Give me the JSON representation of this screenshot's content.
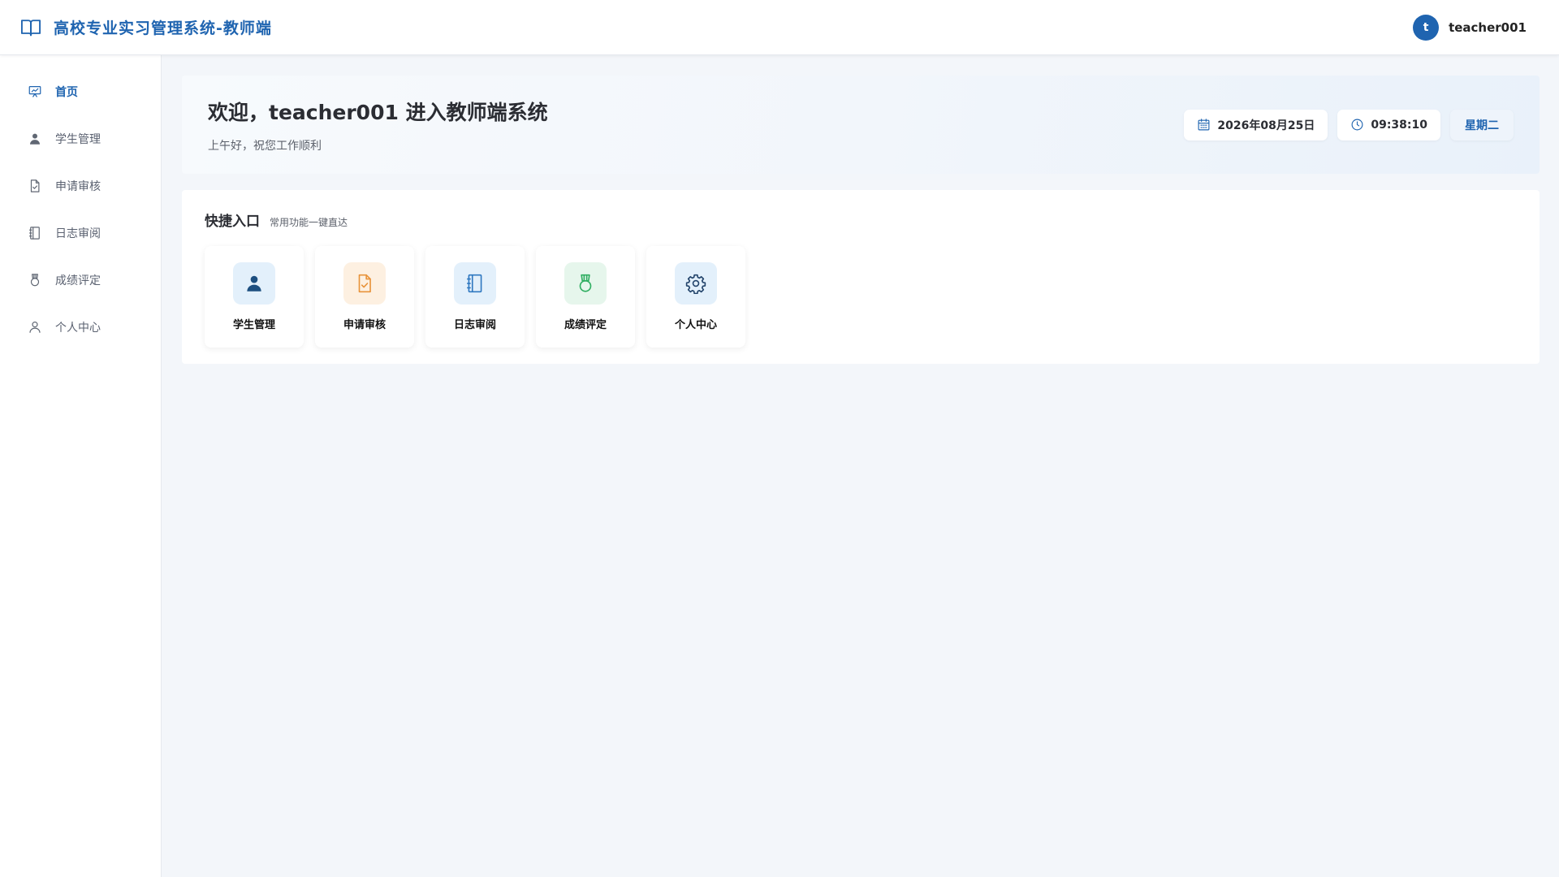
{
  "header": {
    "title": "高校专业实习管理系统-教师端",
    "user": {
      "avatar_letter": "t",
      "name": "teacher001"
    }
  },
  "sidebar": {
    "items": [
      {
        "label": "首页",
        "icon": "dashboard-icon",
        "active": true
      },
      {
        "label": "学生管理",
        "icon": "user-icon"
      },
      {
        "label": "申请审核",
        "icon": "document-check-icon"
      },
      {
        "label": "日志审阅",
        "icon": "notebook-icon"
      },
      {
        "label": "成绩评定",
        "icon": "medal-icon"
      },
      {
        "label": "个人中心",
        "icon": "user-outline-icon"
      }
    ]
  },
  "welcome": {
    "title": "欢迎，teacher001 进入教师端系统",
    "subtitle": "上午好，祝您工作顺利",
    "date": "2026年08月25日",
    "time": "09:38:10",
    "weekday": "星期二"
  },
  "quick": {
    "title": "快捷入口",
    "subtitle": "常用功能一键直达",
    "cards": [
      {
        "label": "学生管理",
        "icon": "user-icon",
        "bg": "#e3f0fb",
        "color": "#1d4f80"
      },
      {
        "label": "申请审核",
        "icon": "document-check-icon",
        "bg": "#fdf0e1",
        "color": "#e8933a"
      },
      {
        "label": "日志审阅",
        "icon": "notebook-icon",
        "bg": "#e3f0fb",
        "color": "#2f78c0"
      },
      {
        "label": "成绩评定",
        "icon": "medal-icon",
        "bg": "#e6f6ec",
        "color": "#2fae61"
      },
      {
        "label": "个人中心",
        "icon": "gear-icon",
        "bg": "#e3f0fb",
        "color": "#23446b"
      }
    ]
  },
  "colors": {
    "accent": "#1f64b0",
    "background": "#f3f6fa"
  }
}
